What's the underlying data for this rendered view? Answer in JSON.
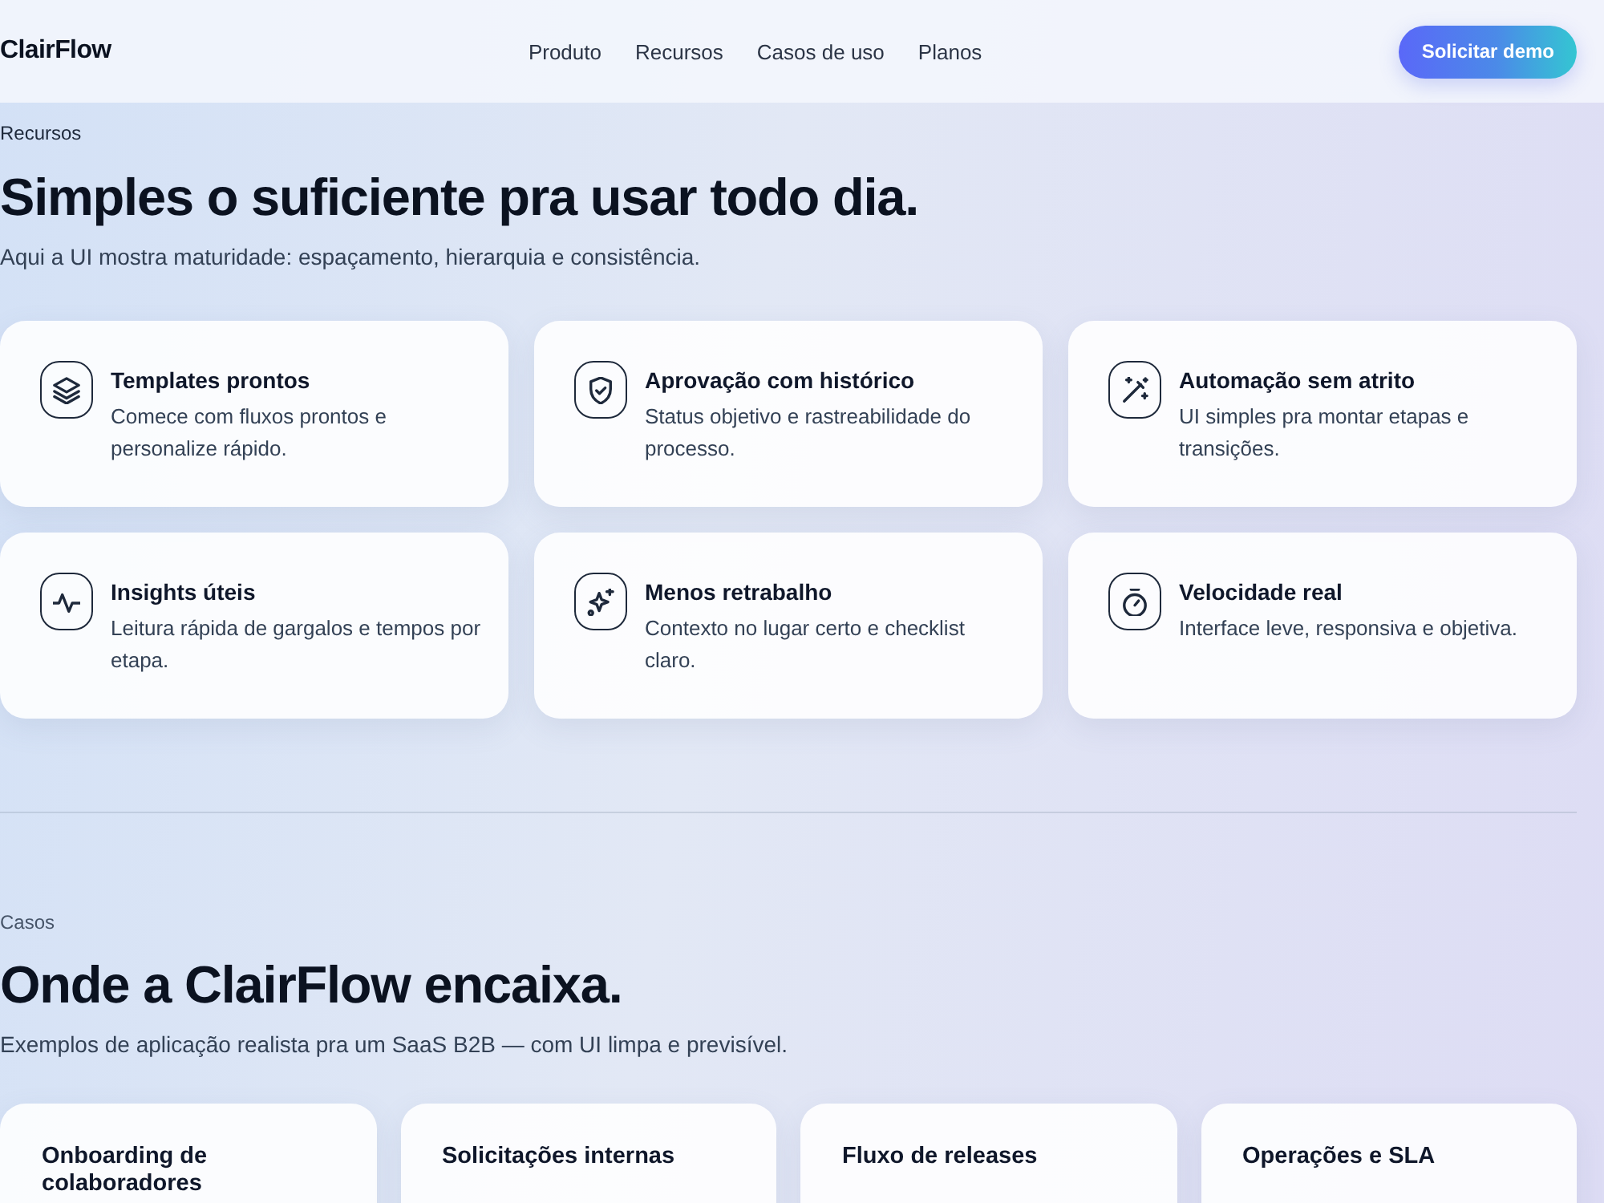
{
  "nav": {
    "logo": "ClairFlow",
    "links": [
      "Produto",
      "Recursos",
      "Casos de uso",
      "Planos"
    ],
    "cta": "Solicitar demo"
  },
  "features": {
    "eyebrow": "Recursos",
    "title": "Simples o suficiente pra usar todo dia.",
    "subtitle": "Aqui a UI mostra maturidade: espaçamento, hierarquia e consistência.",
    "cards": [
      {
        "kind": "layers",
        "title": "Templates prontos",
        "description": "Comece com fluxos prontos e personalize rápido."
      },
      {
        "kind": "shield",
        "title": "Aprovação com histórico",
        "description": "Status objetivo e rastreabilidade do processo."
      },
      {
        "kind": "wand",
        "title": "Automação sem atrito",
        "description": "UI simples pra montar etapas e transições."
      },
      {
        "kind": "pulse",
        "title": "Insights úteis",
        "description": "Leitura rápida de gargalos e tempos por etapa."
      },
      {
        "kind": "sparkles",
        "title": "Menos retrabalho",
        "description": "Contexto no lugar certo e checklist claro."
      },
      {
        "kind": "timer",
        "title": "Velocidade real",
        "description": "Interface leve, responsiva e objetiva."
      }
    ]
  },
  "cases": {
    "eyebrow": "Casos",
    "title": "Onde a ClairFlow encaixa.",
    "subtitle": "Exemplos de aplicação realista pra um SaaS B2B — com UI limpa e previsível.",
    "cards": [
      {
        "title": "Onboarding de colaboradores"
      },
      {
        "title": "Solicitações internas"
      },
      {
        "title": "Fluxo de releases"
      },
      {
        "title": "Operações e SLA"
      }
    ]
  }
}
